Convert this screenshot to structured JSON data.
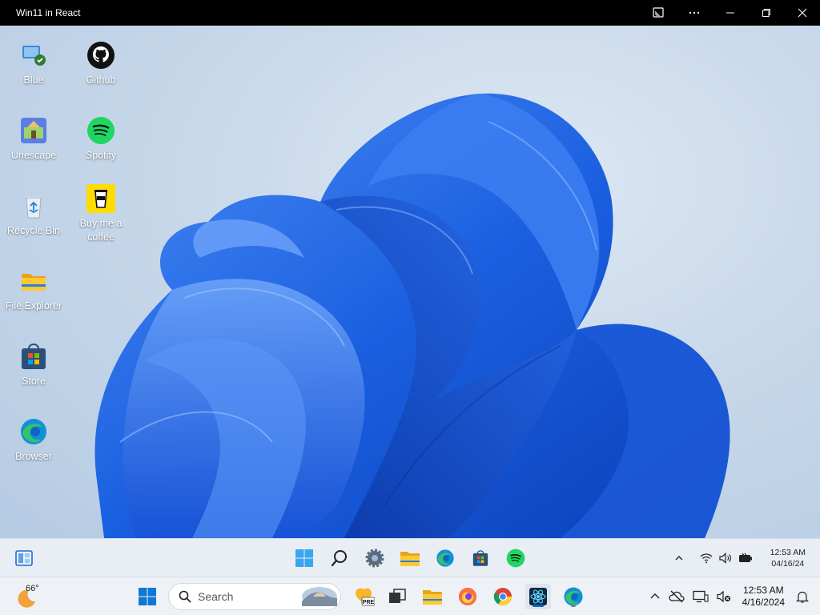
{
  "window": {
    "title": "Win11 in React",
    "controls": [
      "cast-icon",
      "more-icon",
      "minimize-icon",
      "restore-icon",
      "close-icon"
    ]
  },
  "desktop": {
    "icons": [
      {
        "label": "Blue",
        "icon": "blue-app-icon"
      },
      {
        "label": "Github",
        "icon": "github-icon"
      },
      {
        "label": "Unescape",
        "icon": "unescape-icon"
      },
      {
        "label": "Spotify",
        "icon": "spotify-icon"
      },
      {
        "label": "Recycle Bin",
        "icon": "recycle-bin-icon"
      },
      {
        "label": "Buy me a coffee",
        "icon": "coffee-icon"
      },
      {
        "label": "File Explorer",
        "icon": "folder-icon"
      },
      {
        "label": "Store",
        "icon": "store-icon"
      },
      {
        "label": "Browser",
        "icon": "edge-icon"
      }
    ]
  },
  "inner_taskbar": {
    "apps": [
      "widgets-icon",
      "start-icon",
      "search-icon",
      "settings-icon",
      "file-explorer-icon",
      "edge-icon",
      "store-icon",
      "spotify-icon"
    ],
    "tray": {
      "icons": [
        "chevron-up-icon",
        "wifi-icon",
        "volume-icon",
        "battery-icon"
      ],
      "time": "12:53 AM",
      "date": "04/16/24"
    }
  },
  "host_taskbar": {
    "weather": {
      "temp": "66°",
      "icon": "weather-moon-icon"
    },
    "search_placeholder": "Search",
    "apps": [
      "start-icon",
      "search-icon",
      "copilot-pre-icon",
      "task-view-icon",
      "file-explorer-icon",
      "firefox-icon",
      "chrome-icon",
      "win11-react-app-icon",
      "edge-icon"
    ],
    "tray": {
      "icons": [
        "chevron-up-icon",
        "cloud-off-icon",
        "display-icon",
        "volume-mute-icon",
        "bell-icon"
      ],
      "time": "12:53 AM",
      "date": "4/16/2024"
    }
  },
  "colors": {
    "accent": "#0067c0",
    "bloom_blue": "#1a5fe0",
    "desktop_bg": "#c8d8ea"
  }
}
